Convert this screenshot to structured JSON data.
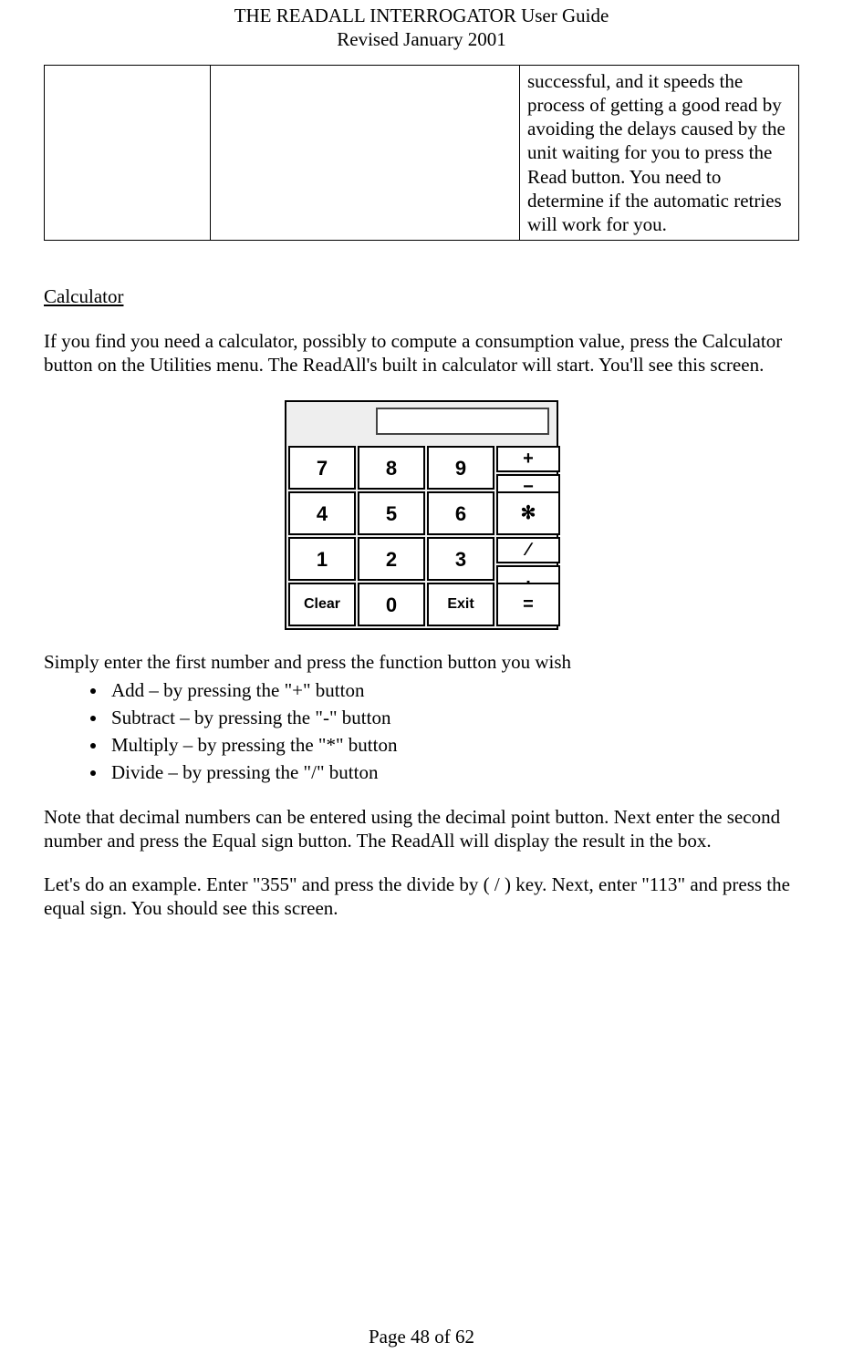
{
  "header": {
    "title": "THE READALL INTERROGATOR User Guide",
    "revised": "Revised January 2001"
  },
  "table_fragment": {
    "col1": "",
    "col2": "",
    "col3": "successful, and it speeds the process of getting a good read by avoiding the delays caused by the unit waiting for you to press the Read button.  You need to determine if the automatic retries will work for you."
  },
  "section": {
    "heading": "Calculator",
    "intro": "If you find you need a calculator, possibly to compute a consumption value, press the Calculator button on the Utilities menu.  The ReadAll's built in calculator will start.  You'll see this screen.",
    "after_calc_lead": "Simply enter the first number and press the function button you wish",
    "bullets": [
      "Add – by pressing the \"+\" button",
      "Subtract – by pressing the \"-\" button",
      "Multiply – by pressing the \"*\" button",
      "Divide – by pressing the \"/\" button"
    ],
    "note": "Note that decimal numbers can be entered using the decimal point button.  Next enter the second number and press the Equal sign button.  The ReadAll will display the result in the box.",
    "example": "Let's do an example.  Enter \"355\" and press the divide by ( / ) key.  Next, enter \"113\" and press the equal sign.  You should see this screen."
  },
  "calculator": {
    "keys": {
      "r1c1": "7",
      "r1c2": "8",
      "r1c3": "9",
      "r2c1": "4",
      "r2c2": "5",
      "r2c3": "6",
      "r3c1": "1",
      "r3c2": "2",
      "r3c3": "3",
      "r4c1": "Clear",
      "r4c2": "0",
      "r4c3": "Exit",
      "op_plus": "+",
      "op_minus": "−",
      "op_times": "✻",
      "op_div": "∕",
      "op_dot": ".",
      "op_eq": "="
    }
  },
  "footer": "Page 48 of 62"
}
